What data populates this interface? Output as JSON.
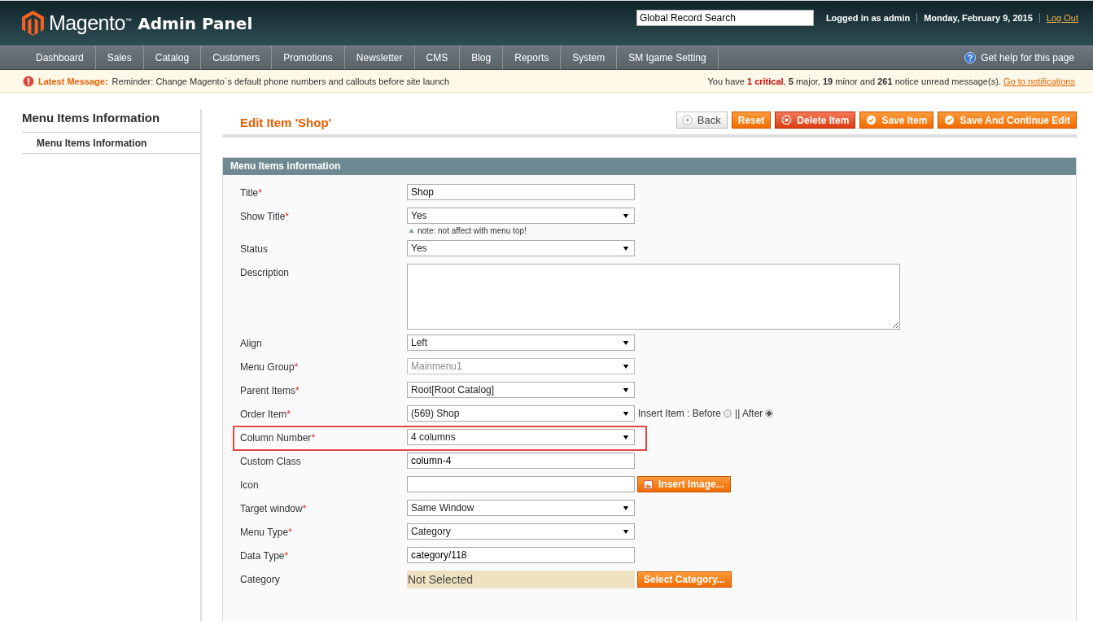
{
  "header": {
    "logo": "Magento$^{™}$",
    "product": "Admin Panel",
    "search": {
      "value": "Global Record Search"
    },
    "user": "Logged in as admin",
    "date": "Monday, February 9, 2015",
    "logout": "Log Out"
  },
  "nav": {
    "items": [
      {
        "label": "Dashboard",
        "selected": false
      },
      {
        "label": "Sales",
        "selected": false
      },
      {
        "label": "Catalog",
        "selected": false
      },
      {
        "label": "Customers",
        "selected": false
      },
      {
        "label": "Promotions",
        "selected": false
      },
      {
        "label": "Newsletter",
        "selected": false
      },
      {
        "label": "CMS",
        "selected": false
      },
      {
        "label": "Blog",
        "selected": false
      },
      {
        "label": "Reports",
        "selected": false
      },
      {
        "label": "System",
        "selected": false
      },
      {
        "label": "SM Igame Setting",
        "selected": false
      }
    ],
    "help": "Get help for this page"
  },
  "message_bar": {
    "label": "Latest Message:",
    "text": "Reminder: Change Magento`s default phone numbers and callouts before site launch",
    "summary": [
      {
        "kind": "plain",
        "text": "You have "
      },
      {
        "kind": "critical",
        "text": "1 critical"
      },
      {
        "kind": "plain",
        "text": ", "
      },
      {
        "kind": "bold",
        "text": "5"
      },
      {
        "kind": "plain",
        "text": " major, "
      },
      {
        "kind": "bold",
        "text": "19"
      },
      {
        "kind": "plain",
        "text": " minor and "
      },
      {
        "kind": "bold",
        "text": "261"
      },
      {
        "kind": "plain",
        "text": " notice unread message(s). "
      }
    ],
    "link": "Go to notifications"
  },
  "sidebar": {
    "title": "Menu Items Information",
    "tabs": [
      {
        "label": "Menu Items Information",
        "selected": true
      }
    ]
  },
  "page_title": "Edit Item 'Shop'",
  "buttons": [
    {
      "kind": "back",
      "label": "Back"
    },
    {
      "kind": "plain",
      "label": "Reset"
    },
    {
      "kind": "delete",
      "label": "Delete Item"
    },
    {
      "kind": "save",
      "label": "Save Item"
    },
    {
      "kind": "save",
      "label": "Save And Continue Edit"
    }
  ],
  "section": {
    "title": "Menu Items information",
    "fields": [
      {
        "label": "Title",
        "required_mark": "*",
        "kind": "text",
        "value": "Shop",
        "disabled": false,
        "highlighted": false
      },
      {
        "label": "Show Title",
        "required_mark": "*",
        "kind": "select",
        "value": "Yes",
        "disabled": false,
        "highlighted": false,
        "note": "note: not affect with menu top!"
      },
      {
        "label": "Status",
        "kind": "select",
        "value": "Yes",
        "disabled": false,
        "highlighted": false
      },
      {
        "label": "Description",
        "kind": "textarea",
        "disabled": false,
        "highlighted": false
      },
      {
        "label": "Align",
        "kind": "select",
        "value": "Left",
        "disabled": false,
        "highlighted": false
      },
      {
        "label": "Menu Group",
        "required_mark": "*",
        "kind": "select",
        "value": "Mainmenu1",
        "disabled": true,
        "highlighted": false
      },
      {
        "label": "Parent Items",
        "required_mark": "*",
        "kind": "select",
        "value": "Root[Root Catalog]",
        "disabled": false,
        "highlighted": false
      },
      {
        "label": "Order Item",
        "required_mark": "*",
        "kind": "select",
        "value": "(569) Shop",
        "disabled": false,
        "highlighted": false,
        "radios": [
          {
            "label": "Insert Item : Before",
            "selected": false
          },
          {
            "label": "|| After",
            "selected": true
          }
        ]
      },
      {
        "label": "Column Number",
        "required_mark": "*",
        "kind": "select",
        "value": "4 columns",
        "disabled": false,
        "highlighted": true
      },
      {
        "label": "Custom Class",
        "kind": "text",
        "value": "column-4",
        "disabled": false,
        "highlighted": false
      },
      {
        "label": "Icon",
        "kind": "text",
        "disabled": false,
        "highlighted": false,
        "button": "Insert Image..."
      },
      {
        "label": "Target window",
        "required_mark": "*",
        "kind": "select",
        "value": "Same Window",
        "disabled": false,
        "highlighted": false
      },
      {
        "label": "Menu Type",
        "required_mark": "*",
        "kind": "select",
        "value": "Category",
        "disabled": false,
        "highlighted": false
      },
      {
        "label": "Data Type",
        "required_mark": "*",
        "kind": "text",
        "value": "category/118",
        "disabled": false,
        "highlighted": false
      },
      {
        "label": "Category",
        "kind": "chooser",
        "value": "Not Selected",
        "disabled": false,
        "highlighted": false,
        "button": "Select Category..."
      }
    ]
  }
}
